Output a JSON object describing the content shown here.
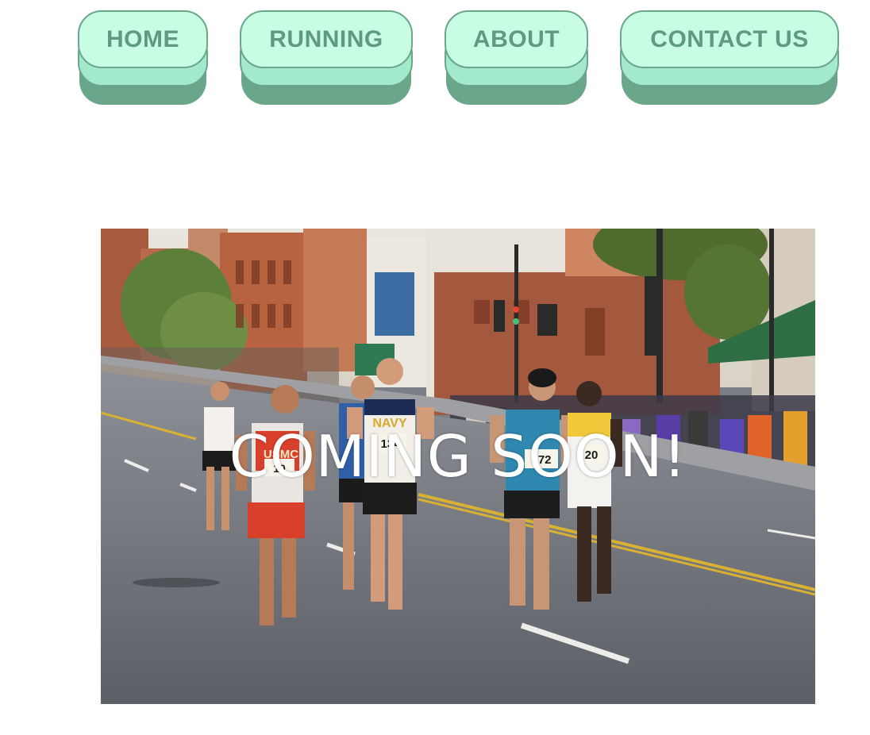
{
  "nav": {
    "items": [
      {
        "label": "HOME"
      },
      {
        "label": "RUNNING"
      },
      {
        "label": "ABOUT"
      },
      {
        "label": "CONTACT US"
      }
    ]
  },
  "hero": {
    "overlay_text": "COMING SOON!",
    "bibs": [
      "USMC",
      "NAVY",
      "134",
      "172",
      "20",
      "10"
    ]
  },
  "colors": {
    "button_face": "#c8fde3",
    "button_mid": "#a3e9cb",
    "button_shadow": "#6aa68a",
    "button_text": "#5f9a80"
  }
}
